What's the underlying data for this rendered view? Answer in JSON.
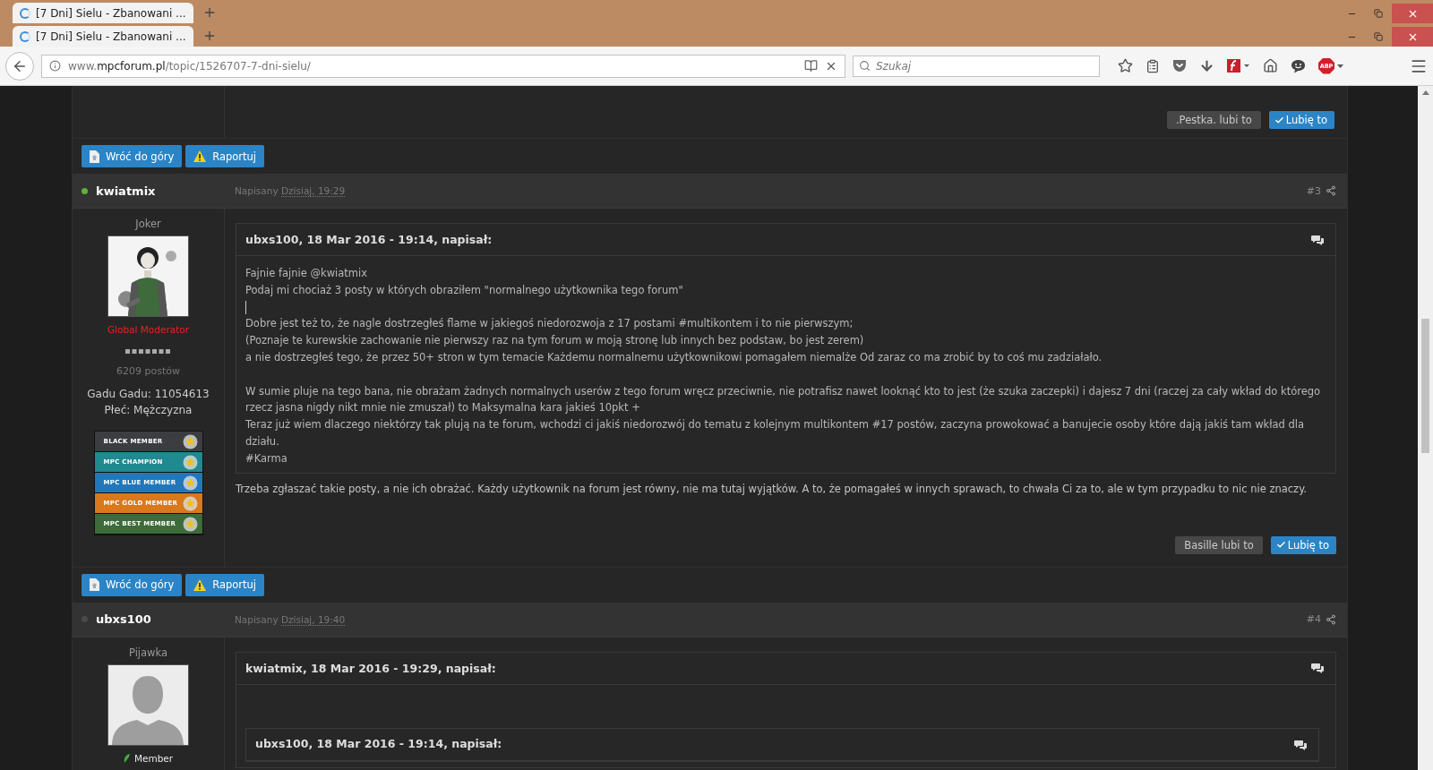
{
  "browser": {
    "tab_rows": [
      {
        "tab_title": "[7 Dni] Sielu - Zbanowani ..."
      },
      {
        "tab_title": "[7 Dni] Sielu - Zbanowani ..."
      }
    ],
    "address": "www.**mpcforum.pl**/topic/1526707-7-dni-sielu/",
    "search": {
      "placeholder": "Szukaj"
    },
    "abp_label": "ABP"
  },
  "previous_post": {
    "likes": {
      "liked_by": ".Pestka. lubi to",
      "like_button": "Lubię to"
    },
    "actions": {
      "back_to_top": "Wróć do góry",
      "report": "Raportuj"
    }
  },
  "posts": [
    {
      "author": "kwiatmix",
      "online": true,
      "posted_label": "Napisany",
      "date": "Dzisiaj, 19:29",
      "number": "#3",
      "rank": "Joker",
      "avatar": {
        "kind": "picture"
      },
      "group": {
        "name": "Global Moderator",
        "color": "#e8231f",
        "icon": false
      },
      "post_count": "6209 postów",
      "profile_fields": [
        "Gadu Gadu: 11054613",
        "Płeć: Mężczyzna"
      ],
      "badges": [
        {
          "label": "BLACK MEMBER",
          "color": "#3b3d40"
        },
        {
          "label": "MPC CHAMPION",
          "color": "#1f8a8f"
        },
        {
          "label": "MPC BLUE MEMBER",
          "color": "#2277b8"
        },
        {
          "label": "MPC GOLD MEMBER",
          "color": "#d9781c"
        },
        {
          "label": "MPC BEST MEMBER",
          "color": "#3d6b3a"
        }
      ],
      "quote": {
        "header": "ubxs100, 18 Mar 2016 - 19:14, napisał:",
        "blocks": [
          {
            "kind": "text",
            "lines": [
              "Fajnie fajnie @kwiatmix",
              "Podaj mi chociaż 3 posty w których obraziłem \"normalnego użytkownika tego forum\""
            ]
          },
          {
            "kind": "caret"
          },
          {
            "kind": "text",
            "lines": [
              "Dobre jest też to, że nagle dostrzegłeś flame w jakiegoś niedorozwoja z 17 postami #multikontem i to nie pierwszym;",
              "(Poznaje te kurewskie zachowanie nie pierwszy raz na tym forum w moją stronę lub innych bez podstaw, bo jest zerem)",
              "a nie dostrzegłeś tego, że przez 50+ stron w tym temacie Każdemu normalnemu użytkownikowi pomagałem niemalże Od zaraz co ma zrobić by to coś mu zadziałało."
            ]
          },
          {
            "kind": "gap"
          },
          {
            "kind": "text",
            "lines": [
              "W sumie pluje na tego bana, nie obrażam żadnych normalnych userów z tego forum wręcz przeciwnie, nie potrafisz nawet looknąć kto to jest (że szuka zaczepki) i dajesz 7 dni (raczej za cały wkład do którego rzecz jasna nigdy nikt mnie nie zmuszał) to Maksymalna kara jakieś 10pkt +",
              "Teraz już wiem dlaczego niektórzy tak plują na te forum, wchodzi ci jakiś niedorozwój do tematu z kolejnym multikontem #17 postów, zaczyna prowokować a banujecie osoby które dają jakiś tam wkład dla działu.",
              "#Karma"
            ]
          }
        ]
      },
      "body": "Trzeba zgłaszać takie posty, a nie ich obrażać. Każdy użytkownik na forum jest równy, nie ma tutaj wyjątków. A to, że pomagałeś w innych sprawach, to chwała Ci za to, ale w tym przypadku to nic nie znaczy.",
      "likes": {
        "liked_by": "Basille lubi to",
        "like_button": "Lubię to"
      },
      "actions": {
        "back_to_top": "Wróć do góry",
        "report": "Raportuj"
      }
    },
    {
      "author": "ubxs100",
      "online": false,
      "posted_label": "Napisany",
      "date": "Dzisiaj, 19:40",
      "number": "#4",
      "rank": "Pijawka",
      "avatar": {
        "kind": "default"
      },
      "group": {
        "name": "Member",
        "color": "#e6e6e6",
        "icon": true
      },
      "quote": {
        "header": "kwiatmix, 18 Mar 2016 - 19:29, napisał:",
        "blocks": [
          {
            "kind": "gap"
          },
          {
            "kind": "quote",
            "header": "ubxs100, 18 Mar 2016 - 19:14, napisał:"
          }
        ]
      }
    }
  ]
}
